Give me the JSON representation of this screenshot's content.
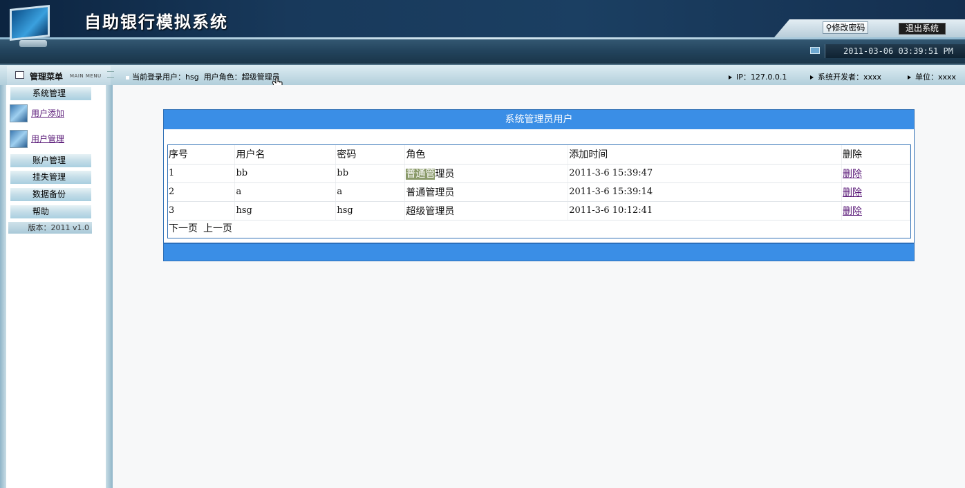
{
  "app": {
    "title": "自助银行模拟系统"
  },
  "header": {
    "change_password_label": "修改密码",
    "logout_label": "退出系统",
    "datetime": "2011-03-06 03:39:51 PM"
  },
  "infobar": {
    "menu_title": "管理菜单",
    "menu_title_en": "MAIN MENU",
    "current_user": "当前登录用户：hsg",
    "user_role": "用户角色：超级管理员",
    "ip": "IP：127.0.0.1",
    "developer": "系统开发者：xxxx",
    "unit": "单位：xxxx"
  },
  "sidebar": {
    "items": [
      {
        "type": "category",
        "label": "系统管理"
      },
      {
        "type": "link",
        "label": "用户添加",
        "icon": "user-add-icon"
      },
      {
        "type": "link",
        "label": "用户管理",
        "icon": "user-manage-icon"
      },
      {
        "type": "category",
        "label": "账户管理"
      },
      {
        "type": "category",
        "label": "挂失管理"
      },
      {
        "type": "category",
        "label": "数据备份"
      },
      {
        "type": "category",
        "label": "帮助"
      }
    ],
    "version": "版本：2011 v1.0"
  },
  "main": {
    "panel_title": "系统管理员用户",
    "columns": [
      "序号",
      "用户名",
      "密码",
      "角色",
      "添加时间",
      "删除"
    ],
    "rows": [
      {
        "id": "1",
        "username": "bb",
        "password": "bb",
        "role_hl": "普通管",
        "role_rest": "理员",
        "added": "2011-3-6 15:39:47",
        "delete": "删除"
      },
      {
        "id": "2",
        "username": "a",
        "password": "a",
        "role_hl": "",
        "role_rest": "普通管理员",
        "added": "2011-3-6 15:39:14",
        "delete": "删除"
      },
      {
        "id": "3",
        "username": "hsg",
        "password": "hsg",
        "role_hl": "",
        "role_rest": "超级管理员",
        "added": "2011-3-6 10:12:41",
        "delete": "删除"
      }
    ],
    "pager": {
      "next": "下一页",
      "prev": "上一页"
    }
  },
  "colors": {
    "accent": "#3a8ee6",
    "header_dark": "#163a5d",
    "link": "#5a1a78"
  }
}
